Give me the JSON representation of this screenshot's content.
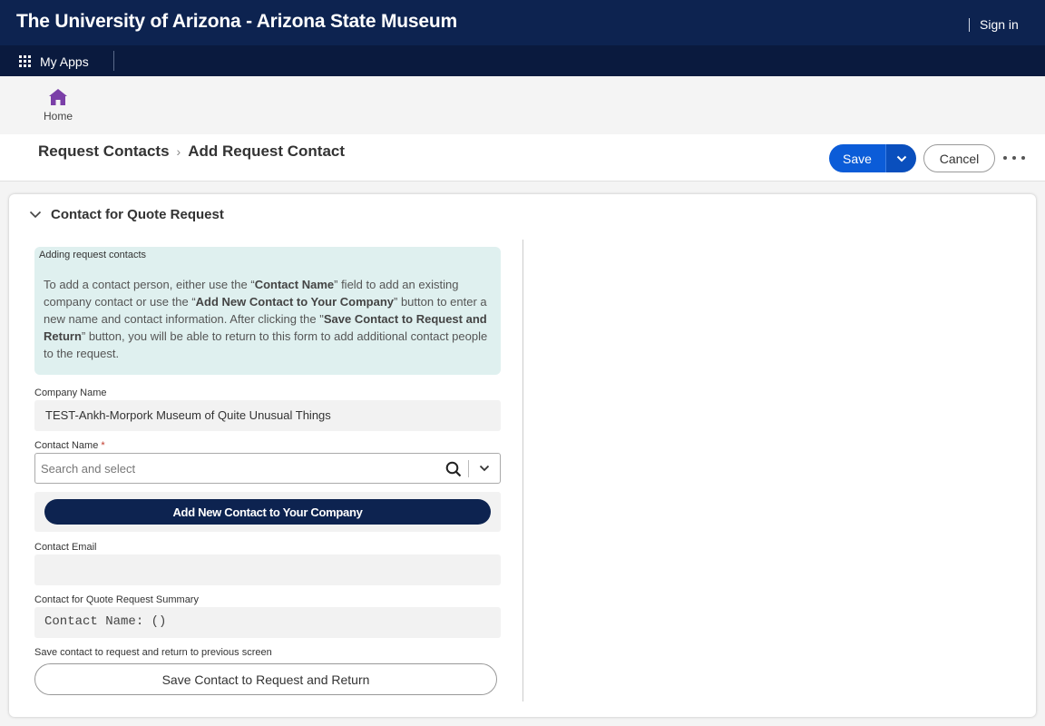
{
  "header": {
    "title": "The University of Arizona - Arizona State Museum",
    "sign_in": "Sign in"
  },
  "apps_bar": {
    "my_apps": "My Apps"
  },
  "nav": {
    "home_label": "Home"
  },
  "breadcrumb": {
    "parent": "Request Contacts",
    "current": "Add Request Contact"
  },
  "toolbar": {
    "save_label": "Save",
    "cancel_label": "Cancel"
  },
  "section": {
    "title": "Contact for Quote Request"
  },
  "info": {
    "heading": "Adding request contacts",
    "text_1": "To add a contact person, either use the “",
    "bold_1": "Contact Name",
    "text_2": "” field to add an existing company contact or use the “",
    "bold_2": "Add New Contact to Your Company",
    "text_3": "” button to enter a new name and contact information. After clicking the \"",
    "bold_3": "Save Contact to Request and Return",
    "text_4": "” button, you will be able to return to this form to add additional contact people to the request."
  },
  "form": {
    "company_name_label": "Company Name",
    "company_name_value": "TEST-Ankh-Morpork Museum of Quite Unusual Things",
    "contact_name_label": "Contact Name",
    "required_mark": "*",
    "contact_name_placeholder": "Search and select",
    "add_contact_button": "Add New Contact to Your Company",
    "contact_email_label": "Contact Email",
    "contact_email_value": "",
    "summary_label": "Contact for Quote Request Summary",
    "summary_value": "Contact Name: ()",
    "save_return_label": "Save contact to request and return to previous screen",
    "save_return_button": "Save Contact to Request and Return"
  },
  "colors": {
    "brand_navy": "#0d2350",
    "primary_blue": "#0b5cd8",
    "info_bg": "#dff0ef",
    "home_icon": "#7b3fa8",
    "required": "#c0392b"
  }
}
